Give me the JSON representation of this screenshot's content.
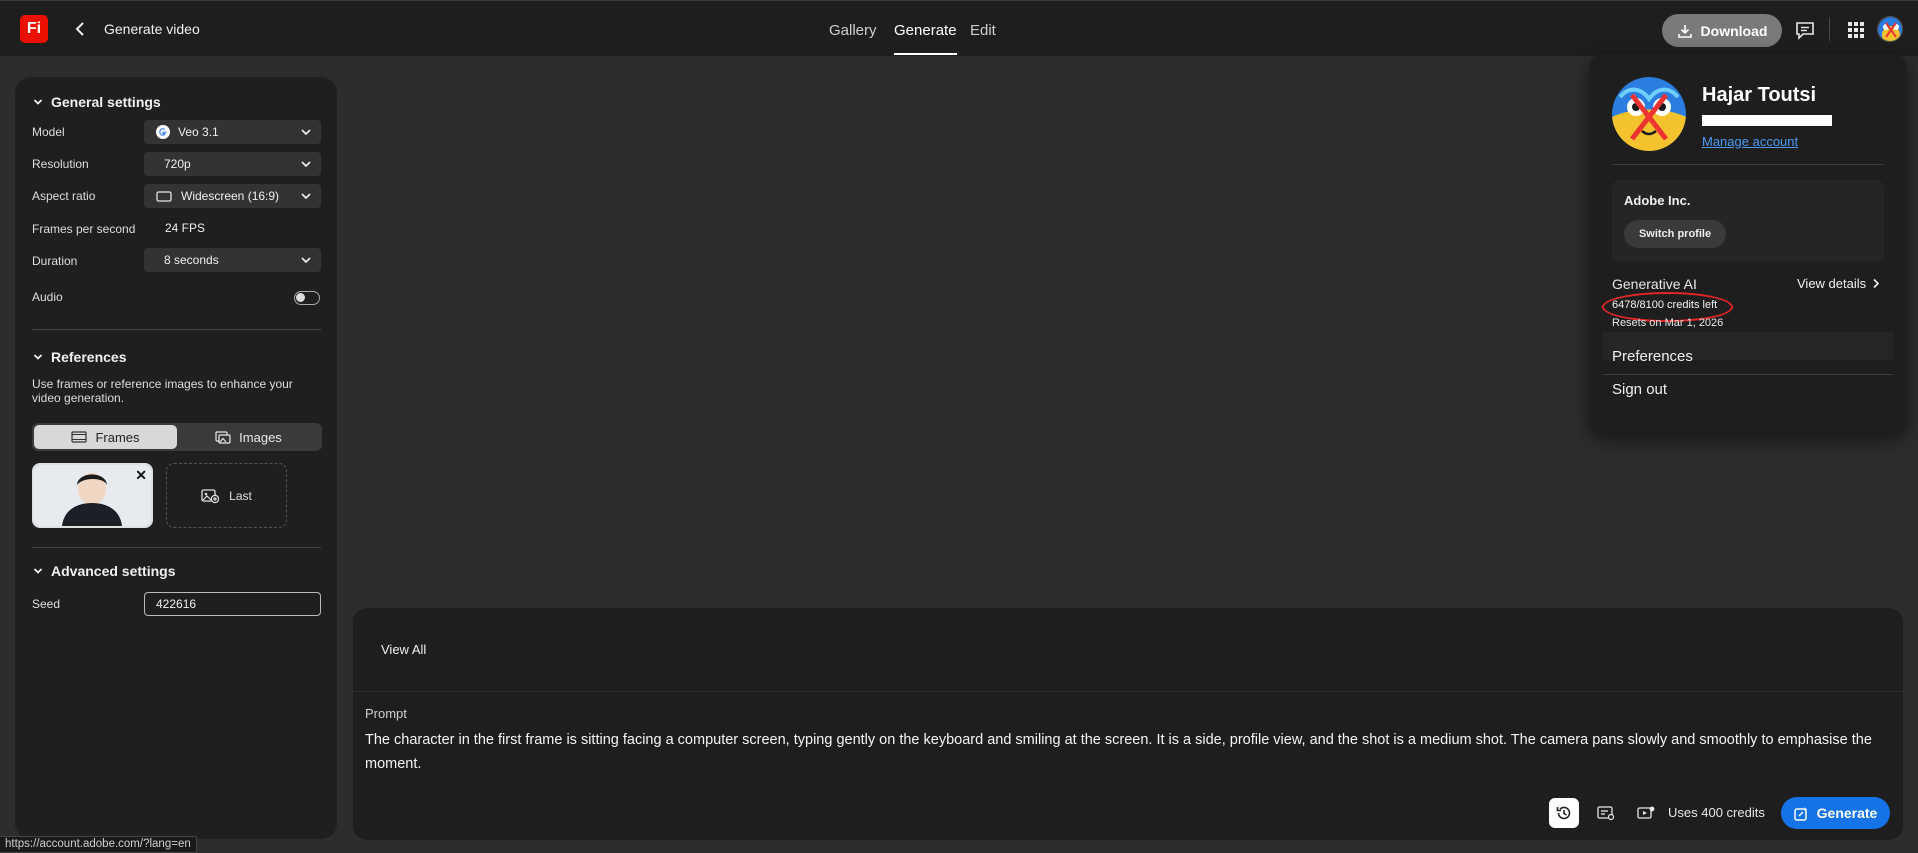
{
  "app": {
    "logo_text": "Fi",
    "page_title": "Generate video",
    "accent": "#1473e6",
    "logo_color": "#eb1000"
  },
  "nav": {
    "tabs": [
      {
        "label": "Gallery"
      },
      {
        "label": "Generate",
        "active": true
      },
      {
        "label": "Edit"
      }
    ]
  },
  "toolbar": {
    "download_label": "Download"
  },
  "general_settings": {
    "heading": "General settings",
    "model_label": "Model",
    "model_value": "Veo 3.1",
    "resolution_label": "Resolution",
    "resolution_value": "720p",
    "aspect_label": "Aspect ratio",
    "aspect_value": "Widescreen (16:9)",
    "fps_label": "Frames per second",
    "fps_value": "24 FPS",
    "duration_label": "Duration",
    "duration_value": "8 seconds",
    "audio_label": "Audio",
    "audio_on": false
  },
  "references": {
    "heading": "References",
    "description": "Use frames or reference images to enhance your video generation.",
    "tabs": [
      {
        "label": "Frames",
        "active": true
      },
      {
        "label": "Images"
      }
    ],
    "last_label": "Last"
  },
  "advanced_settings": {
    "heading": "Advanced settings",
    "seed_label": "Seed",
    "seed_value": "422616"
  },
  "prompt_panel": {
    "view_all": "View All",
    "prompt_label": "Prompt",
    "prompt_text": "The character in the first frame is sitting facing a computer screen, typing gently on the keyboard and smiling at the screen. It is a side, profile view, and the shot is a medium shot. The camera pans slowly and smoothly to emphasise the moment.",
    "uses_credits": "Uses 400 credits",
    "generate_label": "Generate"
  },
  "profile": {
    "name": "Hajar Toutsi",
    "manage_account": "Manage account",
    "org_name": "Adobe Inc.",
    "switch_profile": "Switch profile",
    "gen_ai_label": "Generative AI",
    "view_details": "View details",
    "credits_left": "6478/8100 credits left",
    "resets": "Resets on Mar 1, 2026",
    "preferences": "Preferences",
    "sign_out": "Sign out"
  },
  "status_bar": {
    "url": "https://account.adobe.com/?lang=en"
  }
}
